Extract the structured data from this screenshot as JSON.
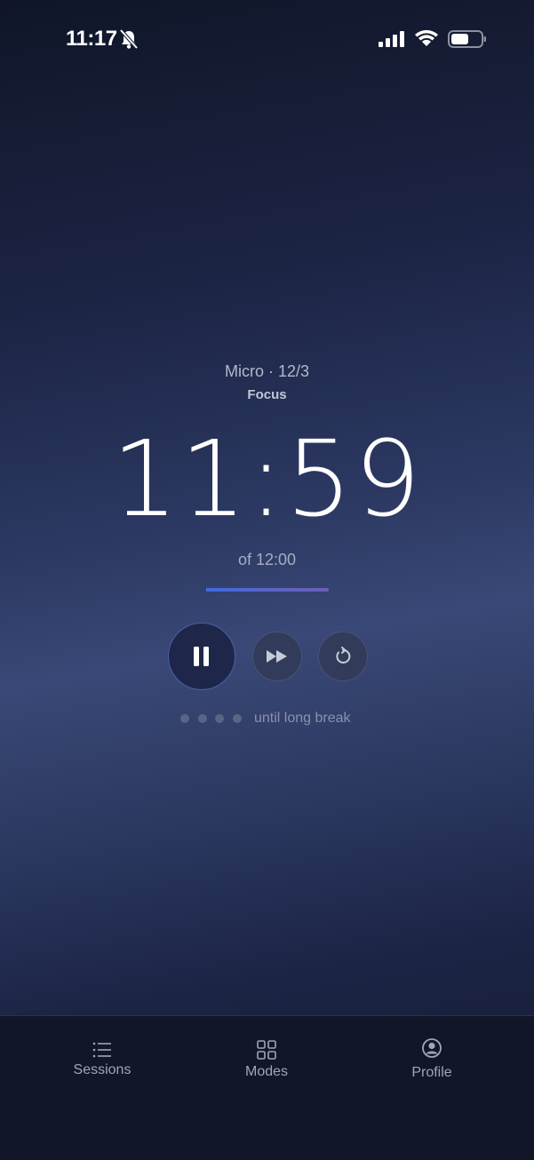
{
  "status_bar": {
    "time": "11:17",
    "icons": [
      "bell-slash-icon",
      "signal-icon",
      "wifi-icon",
      "battery-icon"
    ]
  },
  "session": {
    "mode_line": "Micro · 12/3",
    "phase": "Focus",
    "time_remaining": "11:59",
    "total_label": "of 12:00",
    "progress": 0.0014
  },
  "controls": {
    "pause_icon": "pause-icon",
    "skip_icon": "fast-forward-icon",
    "reset_icon": "reset-icon"
  },
  "long_break": {
    "dots_total": 4,
    "dots_filled": 0,
    "label": "until long break"
  },
  "tab_bar": {
    "tabs": [
      {
        "label": "Sessions",
        "icon": "list-icon"
      },
      {
        "label": "Modes",
        "icon": "grid-icon"
      },
      {
        "label": "Profile",
        "icon": "profile-icon"
      }
    ]
  },
  "colors": {
    "accent": "#4a78f0",
    "background_top": "#101628",
    "background_mid": "#3a4877"
  }
}
